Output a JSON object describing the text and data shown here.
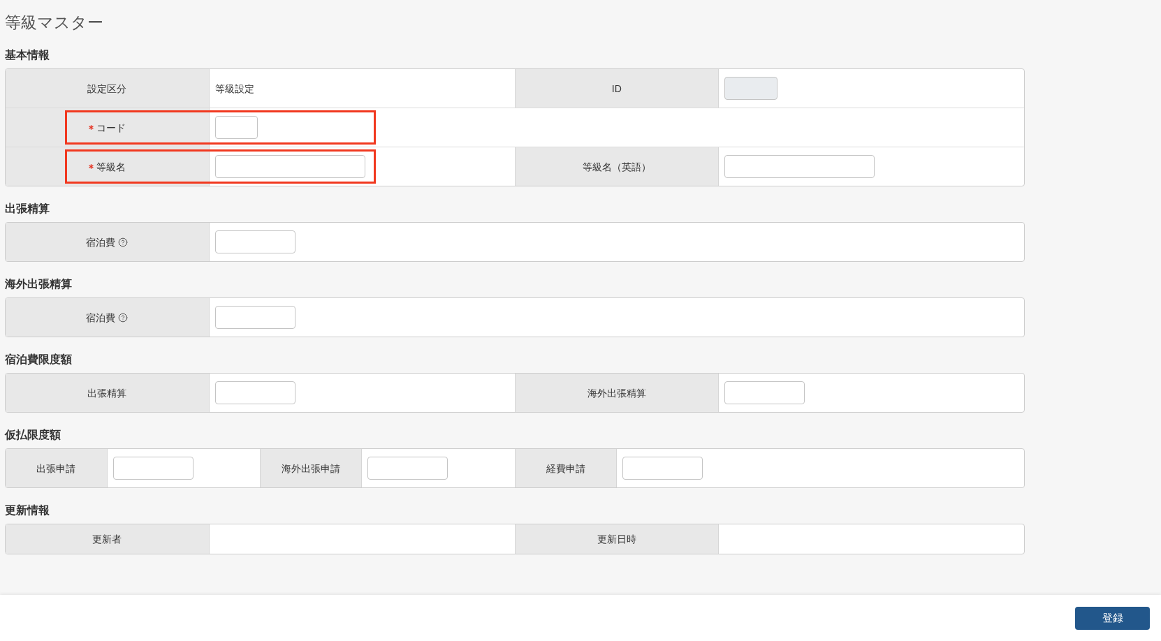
{
  "page": {
    "title": "等級マスター"
  },
  "sections": [
    {
      "heading": "基本情報",
      "rows": [
        {
          "highlighted": false,
          "cells": [
            {
              "label": "設定区分",
              "required": false,
              "help": false,
              "kind": "text",
              "value": "等級設定"
            },
            {
              "label": "ID",
              "required": false,
              "help": false,
              "kind": "id",
              "disabled": true
            }
          ]
        },
        {
          "highlighted": true,
          "cells": [
            {
              "label": "コード",
              "required": true,
              "help": false,
              "kind": "code",
              "disabled": false
            }
          ]
        },
        {
          "highlighted": true,
          "cells": [
            {
              "label": "等級名",
              "required": true,
              "help": false,
              "kind": "name",
              "disabled": false
            },
            {
              "label": "等級名（英語）",
              "required": false,
              "help": false,
              "kind": "name",
              "disabled": false
            }
          ]
        }
      ]
    },
    {
      "heading": "出張精算",
      "rows": [
        {
          "highlighted": false,
          "cells": [
            {
              "label": "宿泊費",
              "required": false,
              "help": true,
              "kind": "amount",
              "disabled": false
            }
          ]
        }
      ]
    },
    {
      "heading": "海外出張精算",
      "rows": [
        {
          "highlighted": false,
          "cells": [
            {
              "label": "宿泊費",
              "required": false,
              "help": true,
              "kind": "amount",
              "disabled": false
            }
          ]
        }
      ]
    },
    {
      "heading": "宿泊費限度額",
      "rows": [
        {
          "highlighted": false,
          "cells": [
            {
              "label": "出張精算",
              "required": false,
              "help": false,
              "kind": "amount",
              "disabled": false
            },
            {
              "label": "海外出張精算",
              "required": false,
              "help": false,
              "kind": "amount",
              "disabled": false
            }
          ]
        }
      ]
    },
    {
      "heading": "仮払限度額",
      "rows": [
        {
          "highlighted": false,
          "cells": [
            {
              "label": "出張申請",
              "required": false,
              "help": false,
              "kind": "amount",
              "disabled": false
            },
            {
              "label": "海外出張申請",
              "required": false,
              "help": false,
              "kind": "amount",
              "disabled": false
            },
            {
              "label": "経費申請",
              "required": false,
              "help": false,
              "kind": "amount",
              "disabled": false
            }
          ]
        }
      ]
    },
    {
      "heading": "更新情報",
      "rows": [
        {
          "highlighted": false,
          "cells": [
            {
              "label": "更新者",
              "required": false,
              "help": false,
              "kind": "text"
            },
            {
              "label": "更新日時",
              "required": false,
              "help": false,
              "kind": "text"
            }
          ]
        }
      ]
    }
  ],
  "footer": {
    "submit_button": {
      "label": "登録"
    }
  }
}
